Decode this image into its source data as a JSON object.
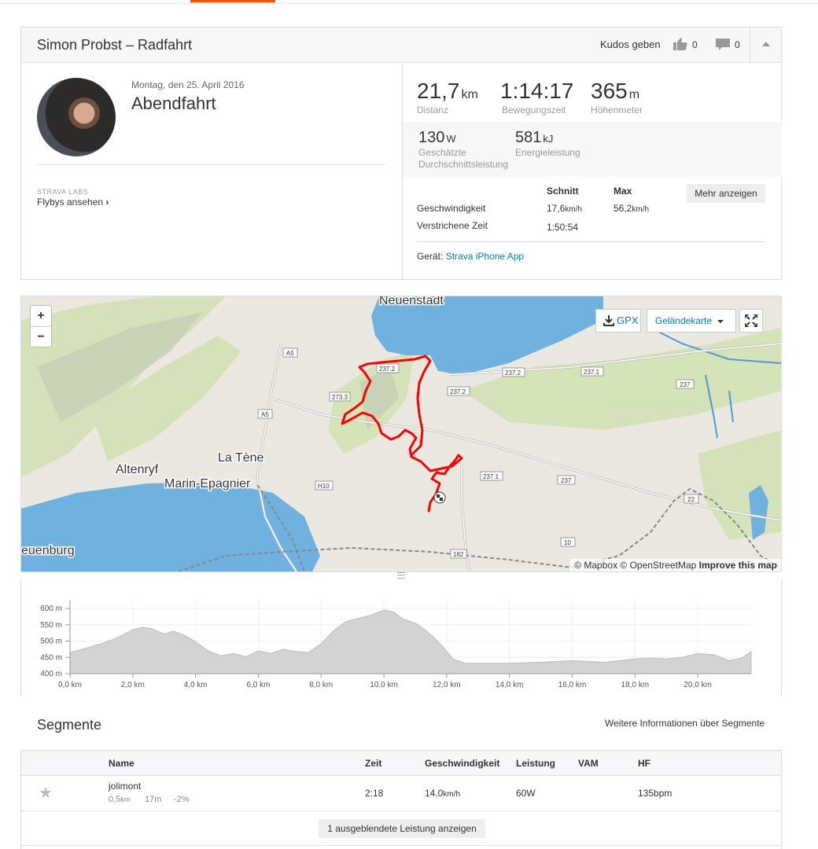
{
  "header": {
    "title": "Simon Probst – Radfahrt",
    "kudos_label": "Kudos geben",
    "kudos_count": "0",
    "comments_count": "0"
  },
  "activity": {
    "date": "Montag, den 25. April 2016",
    "name": "Abendfahrt",
    "labs_label": "STRAVA LABS",
    "flybys_label": "Flybys ansehen"
  },
  "stats": {
    "distance": {
      "value": "21,7",
      "unit": "km",
      "label": "Distanz"
    },
    "moving_time": {
      "value": "1:14:17",
      "label": "Bewegungszeit"
    },
    "elevation": {
      "value": "365",
      "unit": "m",
      "label": "Höhenmeter"
    },
    "power": {
      "value": "130",
      "unit": "W",
      "label_1": "Geschätzte",
      "label_2": "Durchschnittsleistung"
    },
    "energy": {
      "value": "581",
      "unit": "kJ",
      "label": "Energieleistung"
    },
    "col_avg": "Schnitt",
    "col_max": "Max",
    "more_button": "Mehr anzeigen",
    "speed_label": "Geschwindigkeit",
    "speed_avg": "17,6",
    "speed_max": "56,2",
    "speed_unit": "km/h",
    "elapsed_label": "Verstrichene Zeit",
    "elapsed_avg": "1:50:54",
    "device_label": "Gerät:",
    "device_value": "Strava iPhone App"
  },
  "map": {
    "zoom_in": "+",
    "zoom_out": "−",
    "gpx_label": "GPX",
    "layer_label": "Geländekarte",
    "attribution": "© Mapbox © OpenStreetMap",
    "attribution_link": "Improve this map",
    "places": [
      "Neuenstadt",
      "La Tène",
      "Altenryf",
      "Marin-Epagnier",
      "euenburg"
    ],
    "road_labels": [
      "A5",
      "A5",
      "273.3",
      "237.2",
      "237.2",
      "237.2",
      "237.1",
      "237",
      "237.1",
      "237",
      "H10",
      "10",
      "182",
      "22"
    ]
  },
  "elevation_chart": {
    "y_ticks": [
      "600 m",
      "550 m",
      "500 m",
      "450 m",
      "400 m"
    ],
    "x_ticks": [
      "0,0 km",
      "2,0 km",
      "4,0 km",
      "6,0 km",
      "8,0 km",
      "10,0 km",
      "12,0 km",
      "14,0 km",
      "16,0 km",
      "18,0 km",
      "20,0 km"
    ]
  },
  "chart_data": {
    "type": "area",
    "xlabel": "",
    "ylabel": "",
    "xlim": [
      0,
      21.7
    ],
    "ylim": [
      400,
      600
    ],
    "x": [
      0,
      0.5,
      1,
      1.5,
      2,
      2.3,
      2.6,
      3,
      3.3,
      3.6,
      4,
      4.4,
      4.8,
      5.2,
      5.6,
      6,
      6.4,
      6.8,
      7.2,
      7.6,
      8,
      8.4,
      8.8,
      9.2,
      9.6,
      10,
      10.3,
      10.6,
      11,
      11.3,
      11.6,
      11.9,
      12.2,
      12.6,
      13,
      14,
      15,
      16,
      17,
      18,
      18.5,
      19,
      19.5,
      20,
      20.5,
      21,
      21.4,
      21.7
    ],
    "y": [
      465,
      478,
      492,
      510,
      535,
      542,
      538,
      522,
      530,
      520,
      498,
      470,
      455,
      462,
      452,
      470,
      462,
      475,
      468,
      465,
      492,
      532,
      560,
      570,
      580,
      595,
      590,
      568,
      555,
      535,
      510,
      480,
      445,
      432,
      432,
      432,
      435,
      440,
      435,
      445,
      448,
      445,
      450,
      462,
      458,
      440,
      448,
      468
    ]
  },
  "segments": {
    "title": "Segmente",
    "more_link": "Weitere Informationen über Segmente",
    "columns": [
      "Name",
      "Zeit",
      "Geschwindigkeit",
      "Leistung",
      "VAM",
      "HF"
    ],
    "rows": [
      {
        "name": "jolimont",
        "distance": "0,5",
        "distance_unit": "km",
        "elev": "17m",
        "grade": "-2%",
        "time": "2:18",
        "speed": "14,0",
        "speed_unit": "km/h",
        "power": "60W",
        "vam": "",
        "hr": "135bpm"
      }
    ],
    "hidden_button": "1 ausgeblendete Leistung anzeigen"
  },
  "colors": {
    "accent": "#fc5200",
    "link": "#007fb6",
    "route": "#ff0000",
    "water": "#5fa6d6"
  }
}
